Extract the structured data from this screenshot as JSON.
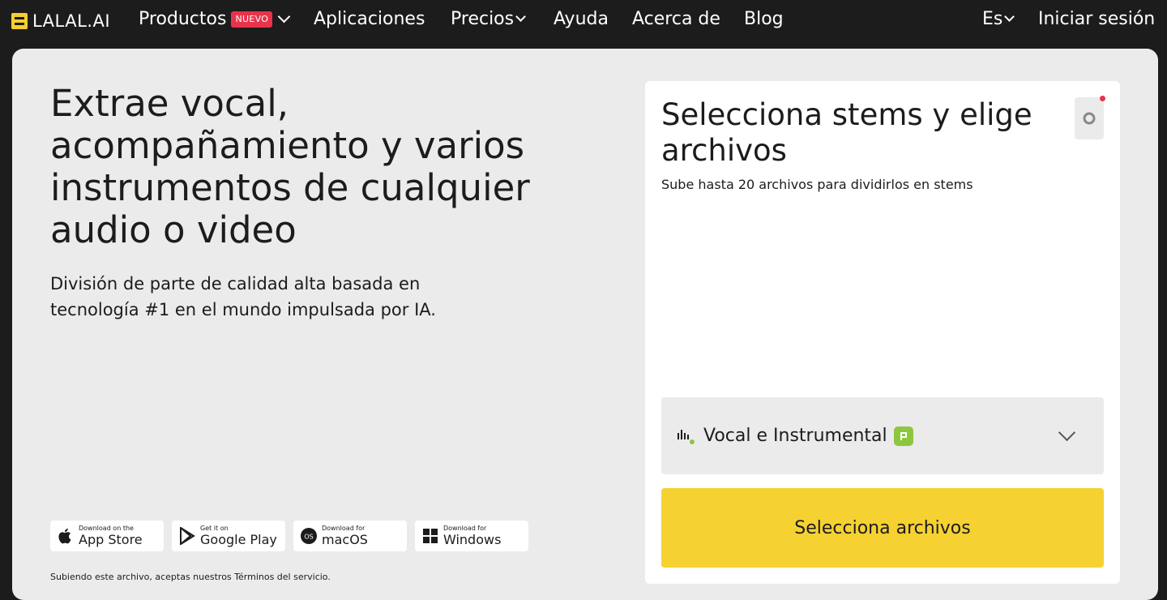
{
  "brand": {
    "name": "LALAL.AI",
    "color": "#f6cf2f"
  },
  "nav": {
    "products": "Productos",
    "products_badge": "NUEVO",
    "apps": "Aplicaciones",
    "pricing": "Precios",
    "help": "Ayuda",
    "about": "Acerca de",
    "blog": "Blog",
    "language": "Es",
    "login": "Iniciar sesión"
  },
  "hero": {
    "title": "Extrae vocal, acompañamiento y varios instrumentos de cualquier audio o video",
    "subtitle": "División de parte de calidad alta basada en tecnología #1 en el mundo impulsada por IA."
  },
  "stores": [
    {
      "small": "Download on the",
      "big": "App Store",
      "icon": "apple-icon"
    },
    {
      "small": "Get it on",
      "big": "Google Play",
      "icon": "google-play-icon"
    },
    {
      "small": "Download for",
      "big": "macOS",
      "icon": "macos-icon"
    },
    {
      "small": "Download for",
      "big": "Windows",
      "icon": "windows-icon"
    }
  ],
  "terms": "Subiendo este archivo, aceptas nuestros Términos del servicio.",
  "panel": {
    "title": "Selecciona stems y elige archivos",
    "subtitle": "Sube hasta 20 archivos para dividirlos en stems",
    "stem_option": "Vocal e Instrumental",
    "button": "Selecciona archivos"
  },
  "colors": {
    "accent": "#f6d132",
    "badge_red": "#e8334a",
    "stem_green": "#8dc63f"
  }
}
